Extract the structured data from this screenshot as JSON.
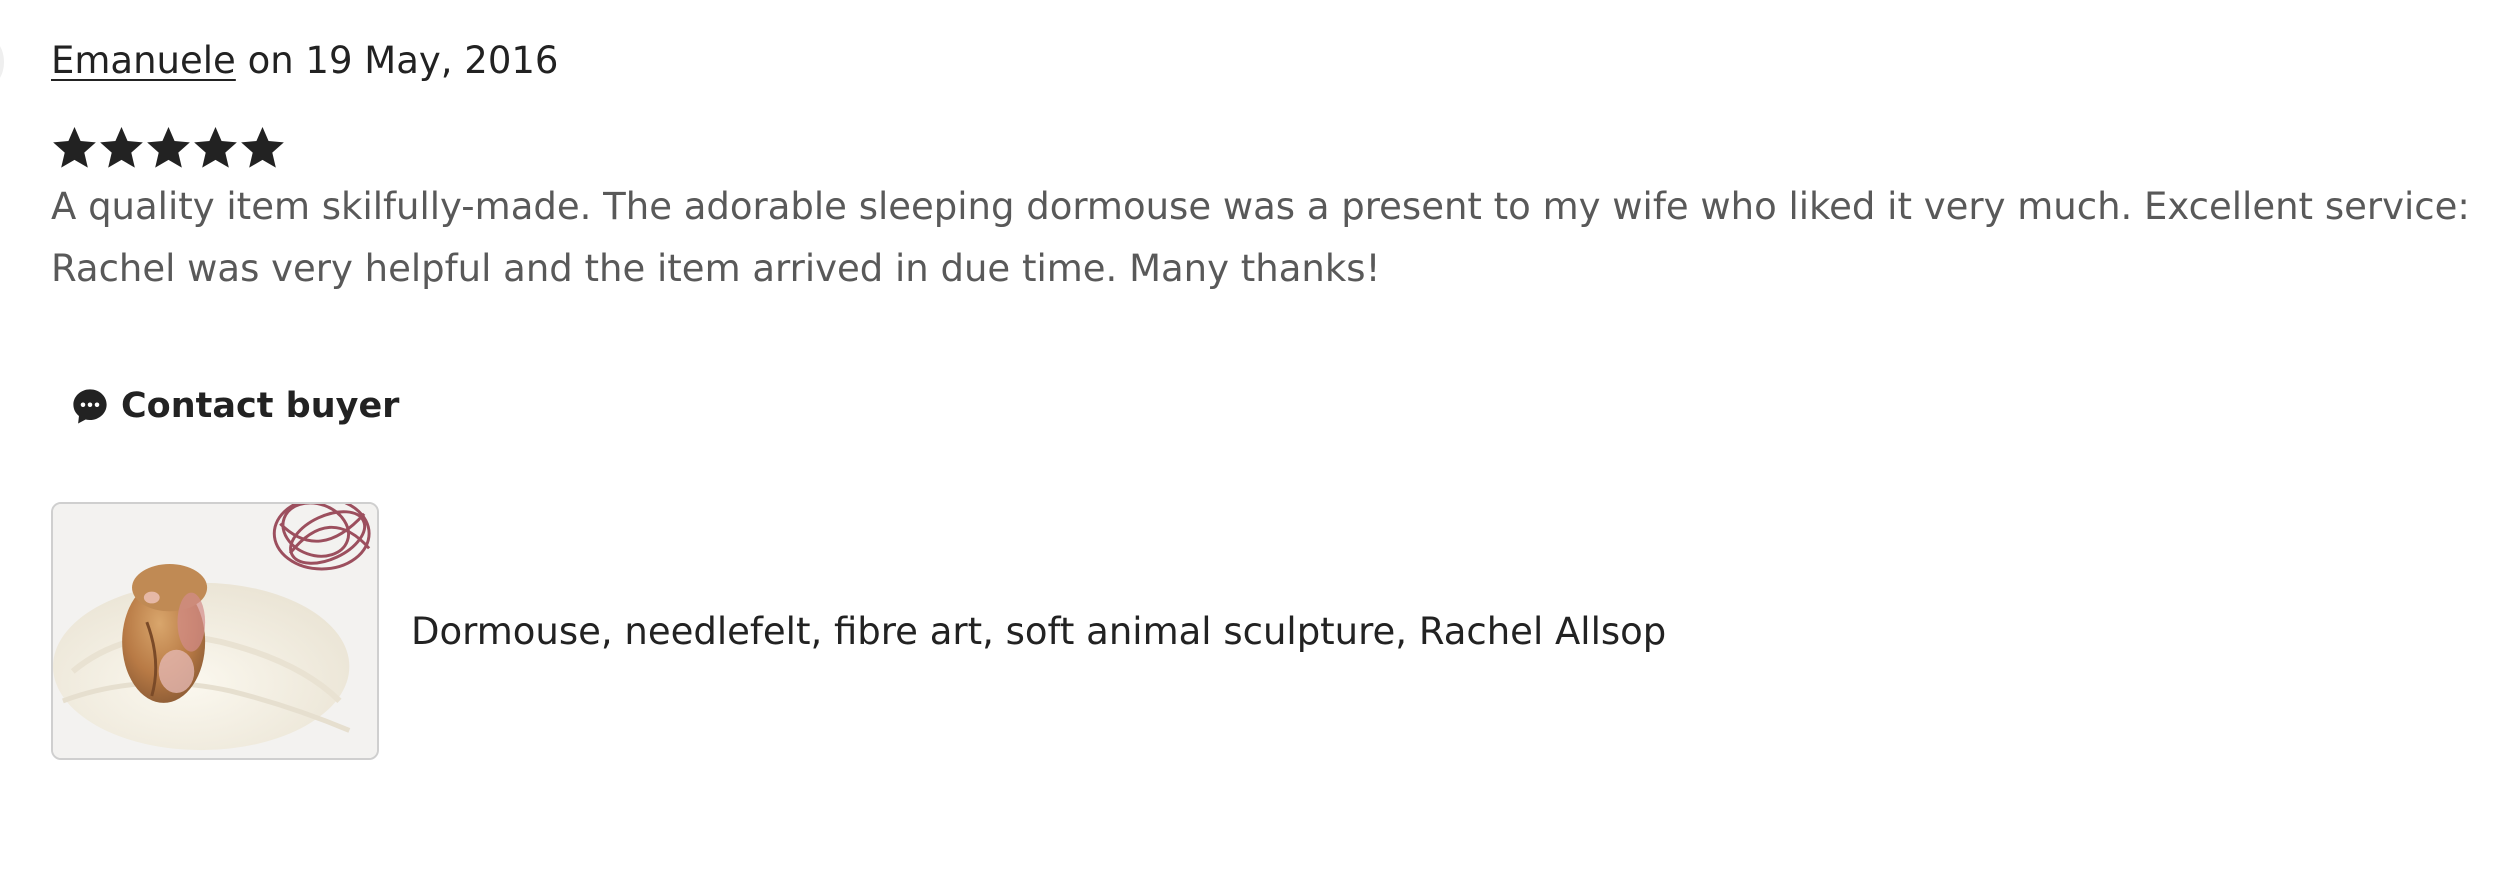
{
  "review": {
    "author": "Emanuele",
    "date_text": " on 19 May, 2016",
    "rating": 5,
    "rating_max": 5,
    "text": "A quality item skilfully-made. The adorable sleeping dormouse was a present to my wife who liked it very much. Excellent service: Rachel was very helpful and the item arrived in due time. Many thanks!"
  },
  "contact": {
    "icon": "chat-bubble-icon",
    "label": "Contact buyer"
  },
  "listing": {
    "title": "Dormouse, needlefelt, fibre art, soft animal sculpture, Rachel Allsop"
  },
  "colors": {
    "text_primary": "#222222",
    "text_secondary": "#595959",
    "star": "#222222",
    "thumb_border": "#cfcfcf"
  }
}
